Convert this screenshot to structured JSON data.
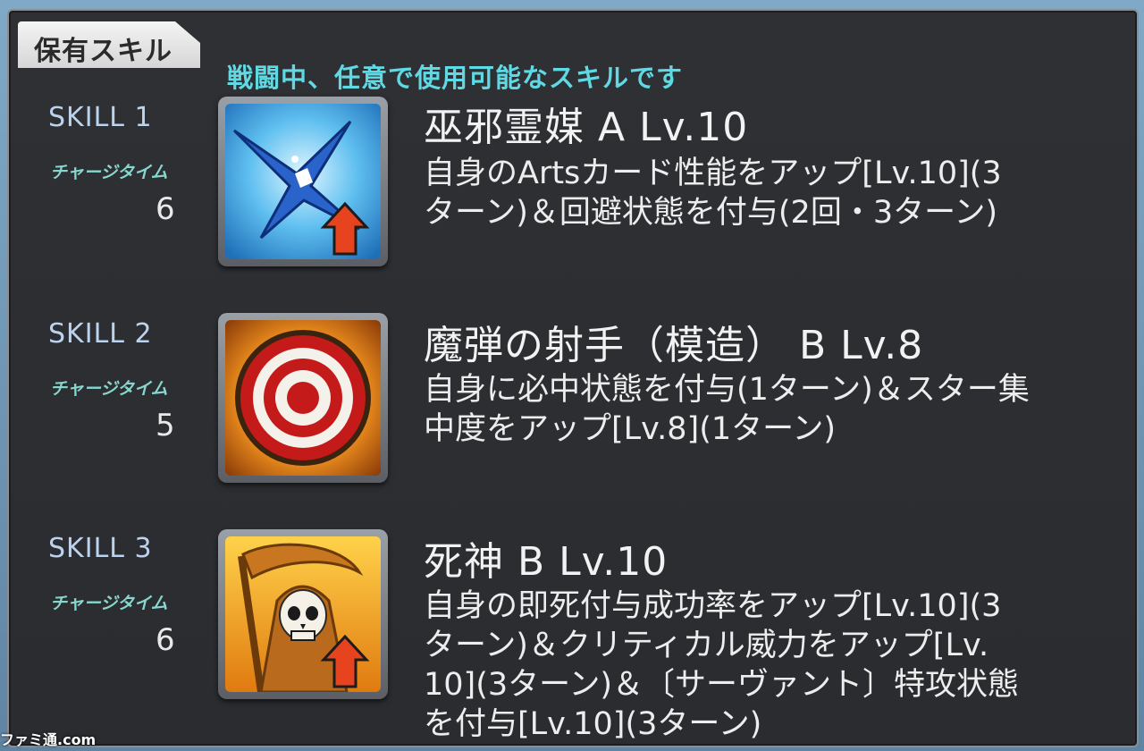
{
  "header": {
    "tab_label": "保有スキル",
    "subtitle": "戦闘中、任意で使用可能なスキルです"
  },
  "skills": [
    {
      "number": "SKILL 1",
      "charge_label": "チャージタイム",
      "charge_value": "6",
      "name": "巫邪霊媒 A Lv.10",
      "desc_lines": [
        "自身のArtsカード性能をアップ[Lv.10](3",
        "ターン)＆回避状態を付与(2回・3ターン)"
      ],
      "icon": "blue-arts-up-icon"
    },
    {
      "number": "SKILL 2",
      "charge_label": "チャージタイム",
      "charge_value": "5",
      "name": "魔弾の射手（模造） B Lv.8",
      "desc_lines": [
        "自身に必中状態を付与(1ターン)＆スター集",
        "中度をアップ[Lv.8](1ターン)"
      ],
      "icon": "target-icon"
    },
    {
      "number": "SKILL 3",
      "charge_label": "チャージタイム",
      "charge_value": "6",
      "name": "死神 B Lv.10",
      "desc_lines": [
        "自身の即死付与成功率をアップ[Lv.10](3",
        "ターン)＆クリティカル威力をアップ[Lv.",
        "10](3ターン)＆〔サーヴァント〕特攻状態",
        "を付与[Lv.10](3ターン)"
      ],
      "icon": "reaper-skull-icon"
    }
  ],
  "watermark": "ファミ通.com"
}
